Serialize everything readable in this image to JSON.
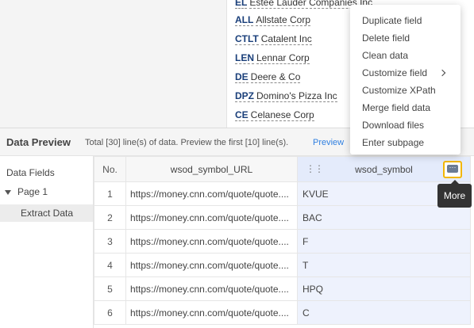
{
  "web_page": {
    "companies": [
      {
        "symbol": "EL",
        "name": "Estee Lauder Companies Inc"
      },
      {
        "symbol": "ALL",
        "name": "Allstate Corp"
      },
      {
        "symbol": "CTLT",
        "name": "Catalent Inc"
      },
      {
        "symbol": "LEN",
        "name": "Lennar Corp"
      },
      {
        "symbol": "DE",
        "name": "Deere & Co"
      },
      {
        "symbol": "DPZ",
        "name": "Domino's Pizza Inc"
      },
      {
        "symbol": "CE",
        "name": "Celanese Corp"
      }
    ]
  },
  "data_preview": {
    "title": "Data Preview",
    "info": "Total [30] line(s) of data. Preview the first [10] line(s).",
    "link": "Preview"
  },
  "left_panel": {
    "heading": "Data Fields",
    "page": "Page 1",
    "extract": "Extract Data"
  },
  "table": {
    "headers": {
      "no": "No.",
      "url": "wsod_symbol_URL",
      "symbol": "wsod_symbol"
    },
    "rows": [
      {
        "no": "1",
        "url": "https://money.cnn.com/quote/quote....",
        "symbol": "KVUE"
      },
      {
        "no": "2",
        "url": "https://money.cnn.com/quote/quote....",
        "symbol": "BAC"
      },
      {
        "no": "3",
        "url": "https://money.cnn.com/quote/quote....",
        "symbol": "F"
      },
      {
        "no": "4",
        "url": "https://money.cnn.com/quote/quote....",
        "symbol": "T"
      },
      {
        "no": "5",
        "url": "https://money.cnn.com/quote/quote....",
        "symbol": "HPQ"
      },
      {
        "no": "6",
        "url": "https://money.cnn.com/quote/quote....",
        "symbol": "C"
      }
    ]
  },
  "tooltip": "More",
  "context_menu": {
    "items": [
      {
        "label": "Duplicate field"
      },
      {
        "label": "Delete field"
      },
      {
        "label": "Clean data"
      },
      {
        "label": "Customize field"
      },
      {
        "label": "Customize XPath"
      },
      {
        "label": "Merge field data"
      },
      {
        "label": "Download files"
      },
      {
        "label": "Enter subpage"
      }
    ]
  },
  "colors": {
    "accent_link": "#2f7fe0",
    "selected_column": "#eef2fd",
    "more_button_outline": "#f2b705",
    "symbol_text": "#1a3f7a"
  }
}
